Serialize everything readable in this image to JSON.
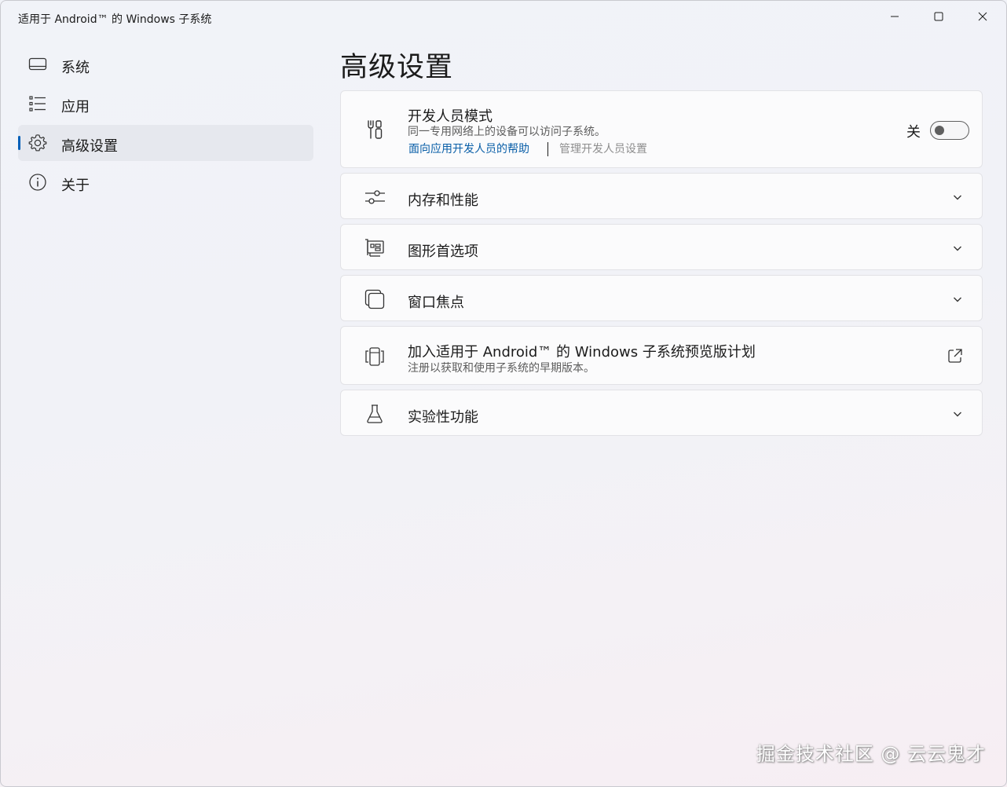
{
  "window": {
    "title": "适用于 Android™ 的 Windows 子系统",
    "controls": {
      "minimize_icon": "minimize-icon",
      "maximize_icon": "maximize-icon",
      "close_icon": "close-icon"
    }
  },
  "sidebar": {
    "items": [
      {
        "label": "系统",
        "icon": "monitor-icon",
        "active": false
      },
      {
        "label": "应用",
        "icon": "list-icon",
        "active": false
      },
      {
        "label": "高级设置",
        "icon": "gear-icon",
        "active": true
      },
      {
        "label": "关于",
        "icon": "info-icon",
        "active": false
      }
    ]
  },
  "main": {
    "title": "高级设置",
    "developer_mode": {
      "title": "开发人员模式",
      "description": "同一专用网络上的设备可以访问子系统。",
      "help_link": "面向应用开发人员的帮助",
      "manage_link": "管理开发人员设置",
      "toggle_state_label": "关",
      "toggle_on": false,
      "icon": "tools-icon"
    },
    "memory": {
      "title": "内存和性能",
      "icon": "sliders-icon"
    },
    "graphics": {
      "title": "图形首选项",
      "icon": "graphics-card-icon"
    },
    "window_focus": {
      "title": "窗口焦点",
      "icon": "window-focus-icon"
    },
    "preview": {
      "title": "加入适用于 Android™ 的 Windows 子系统预览版计划",
      "description": "注册以获取和使用子系统的早期版本。",
      "icon": "preview-program-icon"
    },
    "experimental": {
      "title": "实验性功能",
      "icon": "flask-icon"
    }
  },
  "watermark": "掘金技术社区 @ 云云鬼才",
  "colors": {
    "accent": "#005fb8",
    "link": "#0a5fa8"
  }
}
